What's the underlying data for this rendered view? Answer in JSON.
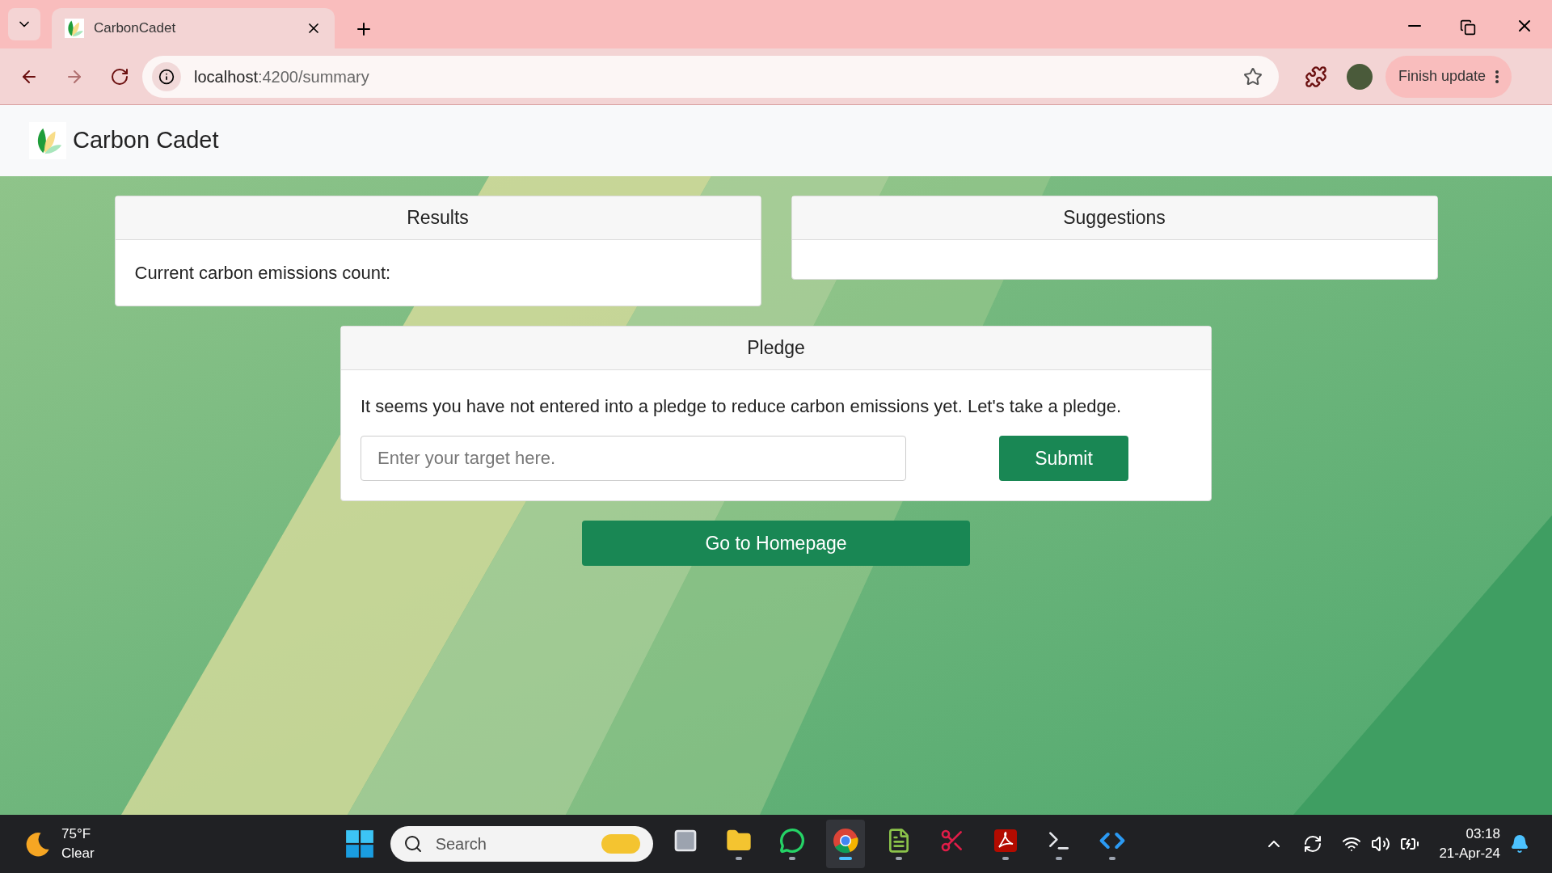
{
  "browser": {
    "tab": {
      "title": "CarbonCadet",
      "selected": true
    },
    "url_host": "localhost",
    "url_path": ":4200/summary",
    "update_button": "Finish update"
  },
  "app": {
    "brand": "Carbon Cadet"
  },
  "cards": [
    {
      "title": "Results",
      "body": "Current carbon emissions count:"
    },
    {
      "title": "Suggestions"
    }
  ],
  "pledge": {
    "title": "Pledge",
    "message": "It seems you have not entered into a pledge to reduce carbon emissions yet. Let's take a pledge.",
    "placeholder": "Enter your target here.",
    "submit": "Submit"
  },
  "homepage_button": "Go to Homepage",
  "taskbar": {
    "weather": {
      "temp": "75°F",
      "condition": "Clear"
    },
    "search_placeholder": "Search",
    "apps": [
      {
        "kind": "taskview",
        "running": false,
        "active": false
      },
      {
        "kind": "files",
        "running": true,
        "active": false
      },
      {
        "kind": "whatsapp",
        "running": true,
        "active": false
      },
      {
        "kind": "chrome",
        "running": true,
        "active": true
      },
      {
        "kind": "notepad",
        "running": true,
        "active": false
      },
      {
        "kind": "snip",
        "running": false,
        "active": false
      },
      {
        "kind": "pdf",
        "running": true,
        "active": false
      },
      {
        "kind": "terminal",
        "running": true,
        "active": false
      },
      {
        "kind": "vscode",
        "running": true,
        "active": false
      }
    ],
    "time": "03:18",
    "date": "21-Apr-24"
  }
}
